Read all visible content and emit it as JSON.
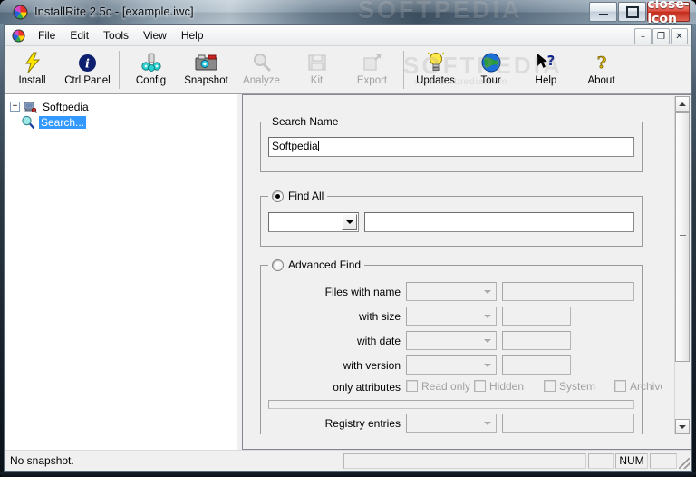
{
  "window": {
    "title": "InstallRite 2.5c - [example.iwc]",
    "watermark": "SOFTPEDIA",
    "watermark_small": "www.softpedia.com",
    "app_icon": "installrite-logo-icon",
    "caption_buttons": [
      {
        "name": "minimize",
        "glyph": "minimize-icon",
        "label": "Minimize"
      },
      {
        "name": "maximize",
        "glyph": "maximize-icon",
        "label": "Maximize"
      },
      {
        "name": "close",
        "glyph": "close-icon",
        "label": "✕"
      }
    ]
  },
  "menu": {
    "icon": "installrite-logo-icon",
    "items": [
      {
        "label": "File"
      },
      {
        "label": "Edit"
      },
      {
        "label": "Tools"
      },
      {
        "label": "View"
      },
      {
        "label": "Help"
      }
    ],
    "mdi_buttons": [
      {
        "name": "mdi-minimize",
        "glyph": "–"
      },
      {
        "name": "mdi-restore",
        "glyph": "❐"
      },
      {
        "name": "mdi-close",
        "glyph": "✕"
      }
    ]
  },
  "toolbar": {
    "items": [
      {
        "label": "Install",
        "icon": "lightning-bolt-icon",
        "enabled": true
      },
      {
        "label": "Ctrl Panel",
        "icon": "info-circle-icon",
        "enabled": true
      },
      {
        "separator_after": true
      },
      {
        "label": "Config",
        "icon": "gears-icon",
        "enabled": true
      },
      {
        "label": "Snapshot",
        "icon": "camera-icon",
        "enabled": true
      },
      {
        "label": "Analyze",
        "icon": "magnifier-icon",
        "enabled": false
      },
      {
        "label": "Kit",
        "icon": "floppy-disk-icon",
        "enabled": false
      },
      {
        "label": "Export",
        "icon": "export-box-icon",
        "enabled": false
      },
      {
        "separator_after": true
      },
      {
        "label": "Updates",
        "icon": "lightbulb-icon",
        "enabled": true
      },
      {
        "label": "Tour",
        "icon": "globe-icon",
        "enabled": true
      },
      {
        "label": "Help",
        "icon": "arrow-question-icon",
        "enabled": true
      },
      {
        "label": "About",
        "icon": "question-mark-icon",
        "enabled": true
      }
    ]
  },
  "tree": {
    "nodes": [
      {
        "label": "Softpedia",
        "icon": "computer-pin-icon",
        "expander": "+",
        "selected": false
      },
      {
        "label": "Search...",
        "icon": "magnifier-blue-icon",
        "expander": "",
        "selected": true
      }
    ]
  },
  "form": {
    "search_name_group": {
      "legend": "Search Name",
      "input_value": "Softpedia",
      "input_placeholder": ""
    },
    "find_all_group": {
      "legend": "Find All",
      "radio_selected": true,
      "combo_value": "",
      "text_value": ""
    },
    "advanced_find_group": {
      "legend": "Advanced Find",
      "radio_selected": false,
      "rows": [
        {
          "label": "Files with name",
          "combo_value": "",
          "text_value": "",
          "wide": true
        },
        {
          "label": "with size",
          "combo_value": "",
          "text_value": "",
          "wide": false
        },
        {
          "label": "with date",
          "combo_value": "",
          "text_value": "",
          "wide": false
        },
        {
          "label": "with version",
          "combo_value": "",
          "text_value": "",
          "wide": false
        }
      ],
      "attributes_label": "only attributes",
      "attributes": [
        {
          "label": "Read only",
          "checked": false
        },
        {
          "label": "Hidden",
          "checked": false
        },
        {
          "label": "System",
          "checked": false
        },
        {
          "label": "Archived",
          "checked": false
        }
      ],
      "registry_row": {
        "label": "Registry entries",
        "combo_value": "",
        "text_value": ""
      }
    }
  },
  "scrollbars": {
    "vertical": {
      "up_icon": "triangle-up-icon",
      "down_icon": "triangle-down-icon",
      "thumb_grip": "grip-icon"
    },
    "horizontal": {
      "left_icon": "triangle-left-icon",
      "right_icon": "triangle-right-icon",
      "thumb_grip": "grip-icon"
    }
  },
  "statusbar": {
    "message": "No snapshot.",
    "progress_pane": "",
    "pane_small": "",
    "num_indicator": "NUM",
    "pane_last": ""
  },
  "colors": {
    "selection_blue": "#3399ff",
    "face": "#f0f0f0",
    "close_red": "#c32b1b",
    "disabled_text": "#a0a0a0"
  }
}
